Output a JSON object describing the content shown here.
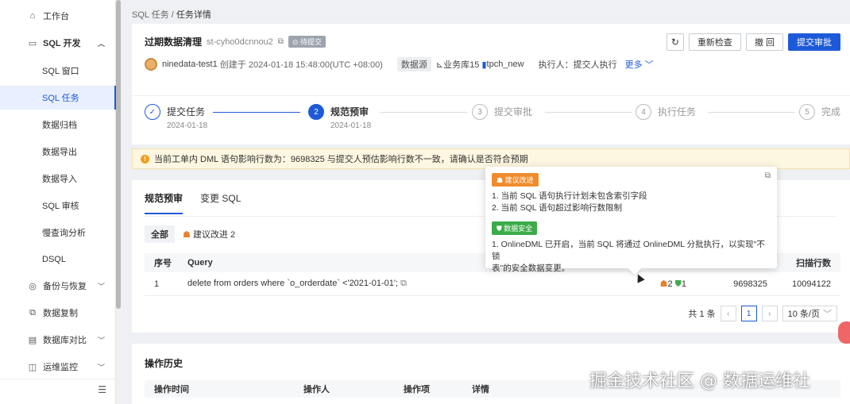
{
  "sidebar": {
    "items": [
      {
        "label": "工作台",
        "icon": "home-icon"
      },
      {
        "label": "SQL 开发",
        "icon": "monitor-icon"
      },
      {
        "label": "SQL 窗口"
      },
      {
        "label": "SQL 任务"
      },
      {
        "label": "数据归档"
      },
      {
        "label": "数据导出"
      },
      {
        "label": "数据导入"
      },
      {
        "label": "SQL 审核"
      },
      {
        "label": "慢查询分析"
      },
      {
        "label": "DSQL"
      },
      {
        "label": "备份与恢复",
        "icon": "backup-icon"
      },
      {
        "label": "数据复制",
        "icon": "copy-icon"
      },
      {
        "label": "数据库对比",
        "icon": "compare-icon"
      },
      {
        "label": "运维监控",
        "icon": "monitor-icon"
      }
    ]
  },
  "breadcrumb": {
    "parent": "SQL 任务",
    "sep": "/",
    "current": "任务详情"
  },
  "task": {
    "title": "过期数据清理",
    "id": "st-cyho0dcnnou2",
    "status": "待提交",
    "creator": "ninedata-test1",
    "created": "创建于 2024-01-18 15:48:00(UTC +08:00)",
    "ds_label": "数据源",
    "ds_path": "业务库15",
    "db": "tpch_new",
    "executor": "执行人：提交人执行",
    "more": "更多"
  },
  "actions": {
    "recheck": "重新检查",
    "withdraw": "撤 回",
    "submit": "提交审批"
  },
  "steps": [
    {
      "no": "",
      "name": "提交任务",
      "date": "2024-01-18"
    },
    {
      "no": "2",
      "name": "规范预审",
      "date": "2024-01-18"
    },
    {
      "no": "3",
      "name": "提交审批",
      "date": ""
    },
    {
      "no": "4",
      "name": "执行任务",
      "date": ""
    },
    {
      "no": "5",
      "name": "完成",
      "date": ""
    }
  ],
  "warning": "当前工单内 DML 语句影响行数为：9698325 与提交人预估影响行数不一致，请确认是否符合预期",
  "review": {
    "tabs": [
      "规范预审",
      "变更 SQL"
    ],
    "filter_all": "全部",
    "filter_suggest": "建议改进 2",
    "columns": {
      "no": "序号",
      "query": "Query",
      "scan": "扫描行数"
    },
    "rows": [
      {
        "no": "1",
        "query": "delete from orders where `o_orderdate` <'2021-01-01';",
        "suggest": "2",
        "safe": "1",
        "affected": "9698325",
        "scan": "10094122"
      }
    ],
    "pager": {
      "total": "共 1 条",
      "page": "1",
      "size": "10 条/页"
    }
  },
  "popover": {
    "tag1": "建议改进",
    "line1": "1. 当前 SQL 语句执行计划未包含索引字段",
    "line2": "2. 当前 SQL 语句超过影响行数限制",
    "tag2": "数据安全",
    "line3": "1. OnlineDML 已开启，当前 SQL 将通过 OnlineDML 分批执行，以实现\"不锁",
    "line4": "表\"的安全数据变更。"
  },
  "history": {
    "title": "操作历史",
    "columns": [
      "操作时间",
      "操作人",
      "操作项",
      "详情"
    ]
  },
  "watermark": "掘金技术社区 @ 数据运维社",
  "colors": {
    "primary": "#1d5ad9",
    "warning_bg": "#fdf6e0",
    "suggest": "#f08c2e",
    "safe": "#3cab4a"
  }
}
